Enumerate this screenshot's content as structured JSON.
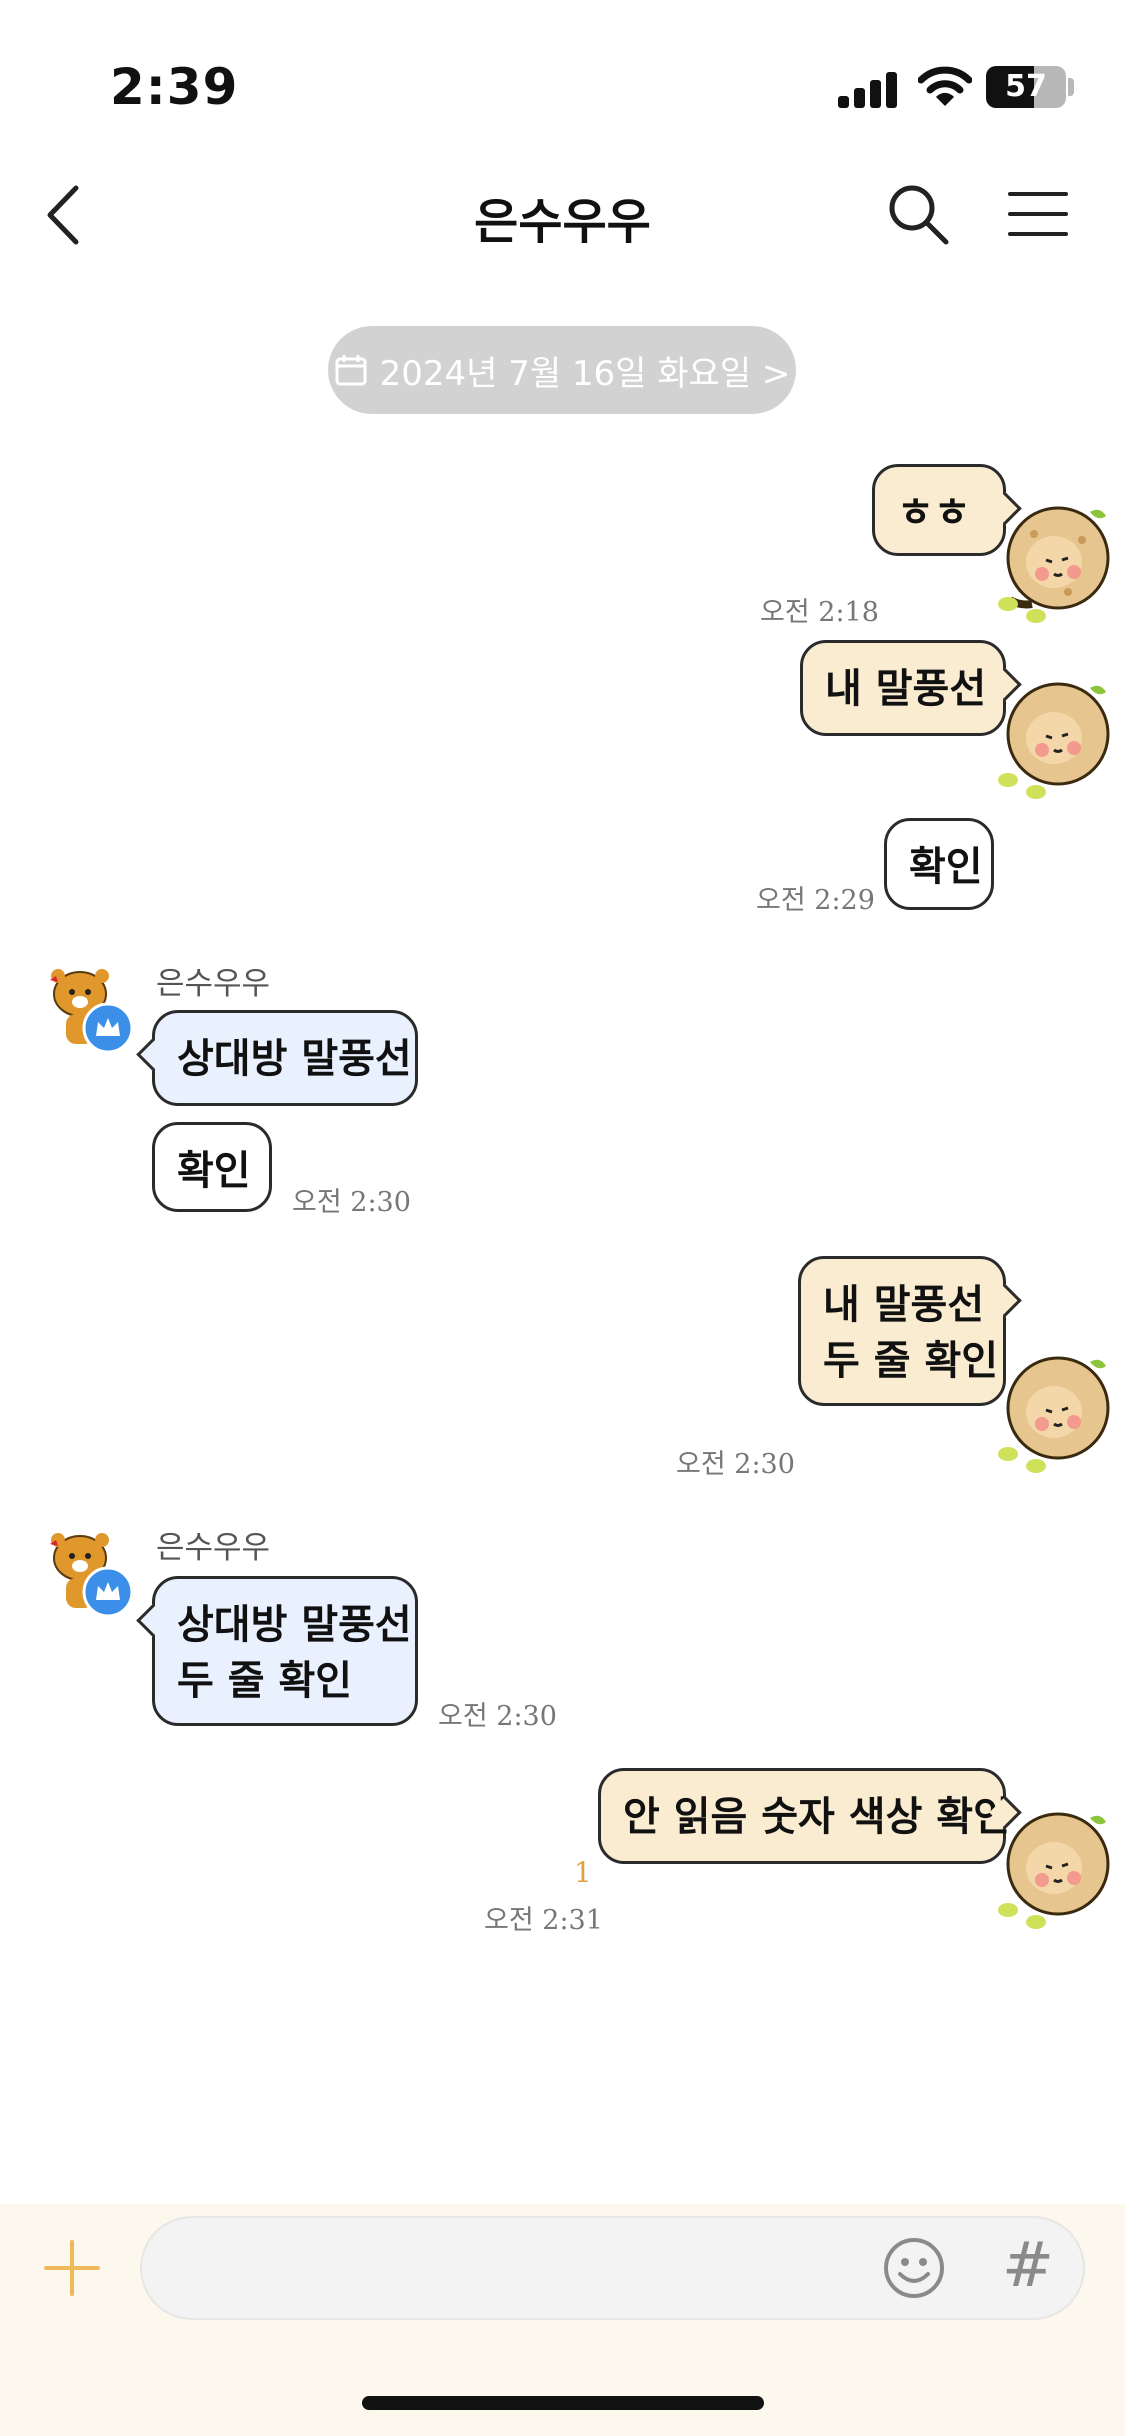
{
  "status_bar": {
    "time": "2:39",
    "battery": "57"
  },
  "header": {
    "title": "은수우우",
    "back_icon": "chevron-left-icon",
    "search_icon": "search-icon",
    "menu_icon": "hamburger-menu-icon"
  },
  "date_divider": {
    "label": "2024년 7월 16일 화요일 >",
    "icon": "calendar-icon"
  },
  "messages": [
    {
      "from": "me",
      "text": "ㅎㅎ",
      "time": ""
    },
    {
      "from": "me",
      "text": "내 말풍선",
      "time": "오전 2:18"
    },
    {
      "from": "me",
      "text": "확인",
      "time": "오전 2:29"
    },
    {
      "from": "them",
      "sender": "은수우우",
      "text": "상대방 말풍선",
      "time": ""
    },
    {
      "from": "them",
      "text": "확인",
      "time": "오전 2:30"
    },
    {
      "from": "me",
      "line1": "내 말풍선",
      "line2": "두 줄 확인",
      "time": "오전 2:30"
    },
    {
      "from": "them",
      "sender": "은수우우",
      "line1": "상대방 말풍선",
      "line2": "두 줄 확인",
      "time": "오전 2:30"
    },
    {
      "from": "me",
      "text": "안 읽음 숫자 색상 확인",
      "unread": "1",
      "time": "오전 2:31"
    }
  ],
  "input_bar": {
    "plus_icon": "plus-icon",
    "emoji_icon": "emoji-icon",
    "hash_label": "#"
  },
  "colors": {
    "my_bubble": "#faecd0",
    "their_bubble": "#e9f1ff",
    "unread_count": "#e0a040",
    "date_pill": "#d2d2d2"
  }
}
